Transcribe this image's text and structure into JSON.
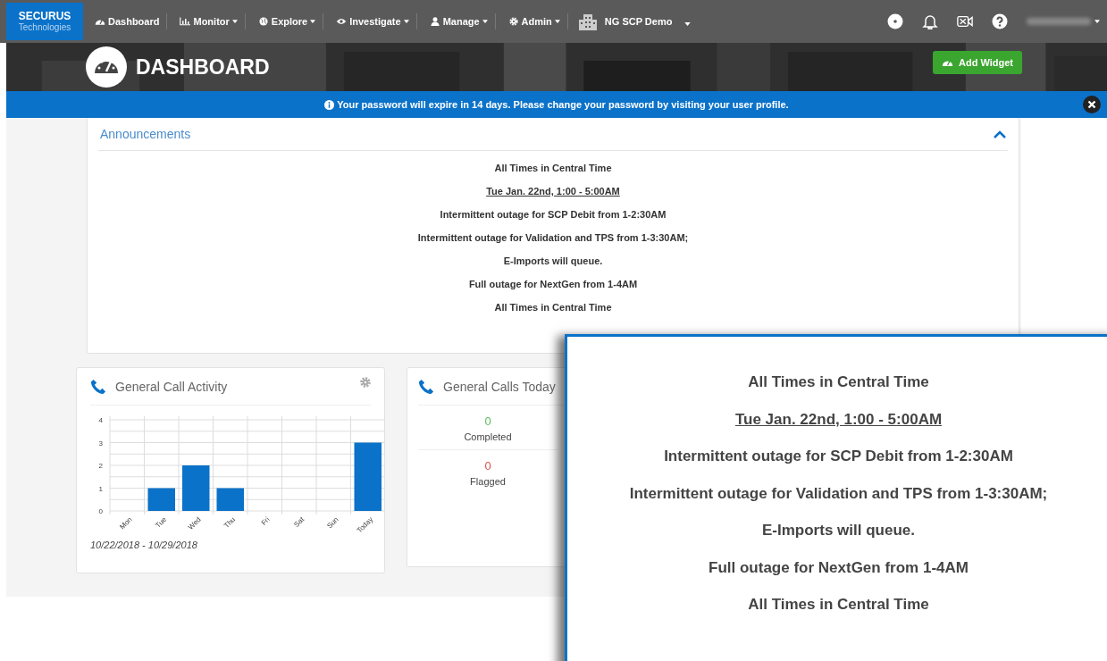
{
  "nav": {
    "logo": {
      "title": "SECURUS",
      "subtitle": "Technologies"
    },
    "items": [
      {
        "label": "Dashboard",
        "kind": "gauge",
        "has_menu": false
      },
      {
        "label": "Monitor",
        "kind": "chart",
        "has_menu": true
      },
      {
        "label": "Explore",
        "kind": "globe",
        "has_menu": true
      },
      {
        "label": "Investigate",
        "kind": "eye",
        "has_menu": true
      },
      {
        "label": "Manage",
        "kind": "user",
        "has_menu": true
      },
      {
        "label": "Admin",
        "kind": "gear",
        "has_menu": true
      }
    ],
    "facility": {
      "label": "NG SCP Demo"
    }
  },
  "header": {
    "title": "DASHBOARD",
    "button": "Add Widget"
  },
  "alert": {
    "text": "Your password will expire in 14 days. Please change your password by visiting your user profile."
  },
  "announcements": {
    "title": "Announcements",
    "expanded": true,
    "lines": [
      {
        "text": "All Times in Central Time",
        "underlined": false
      },
      {
        "text": "Tue Jan. 22nd, 1:00 - 5:00AM",
        "underlined": true
      },
      {
        "text": "Intermittent outage for SCP Debit from 1-2:30AM",
        "underlined": false
      },
      {
        "text": "Intermittent outage for Validation and TPS from 1-3:30AM;",
        "underlined": false
      },
      {
        "text": "E-Imports will queue.",
        "underlined": false
      },
      {
        "text": "Full outage for NextGen from 1-4AM",
        "underlined": false
      },
      {
        "text": "All Times in Central Time",
        "underlined": false
      }
    ]
  },
  "call_activity": {
    "title": "General Call Activity",
    "date_range": "10/22/2018 - 10/29/2018",
    "chart_data": {
      "type": "bar",
      "categories": [
        "Mon",
        "Tue",
        "Wed",
        "Thu",
        "Fri",
        "Sat",
        "Sun",
        "Today"
      ],
      "values": [
        0,
        1,
        2,
        1,
        0,
        0,
        0,
        3
      ],
      "ylim": [
        0,
        4
      ],
      "yticks": [
        0,
        1,
        2,
        3,
        4
      ],
      "grid": true
    }
  },
  "calls_today": {
    "title": "General Calls Today",
    "stats": [
      {
        "value": "0",
        "label": "Completed",
        "color": "#5cb85c"
      },
      {
        "value": "0",
        "label": "Flagged",
        "color": "#d9534f"
      }
    ]
  },
  "zoom_callout": {
    "lines": [
      {
        "text": "All Times in Central Time",
        "underlined": false
      },
      {
        "text": "Tue Jan. 22nd, 1:00 - 5:00AM",
        "underlined": true
      },
      {
        "text": "Intermittent outage for SCP Debit from 1-2:30AM",
        "underlined": false
      },
      {
        "text": "Intermittent outage for Validation and TPS from 1-3:30AM;",
        "underlined": false
      },
      {
        "text": "E-Imports will queue.",
        "underlined": false
      },
      {
        "text": "Full outage for NextGen from 1-4AM",
        "underlined": false
      },
      {
        "text": "All Times in Central Time",
        "underlined": false
      }
    ]
  }
}
